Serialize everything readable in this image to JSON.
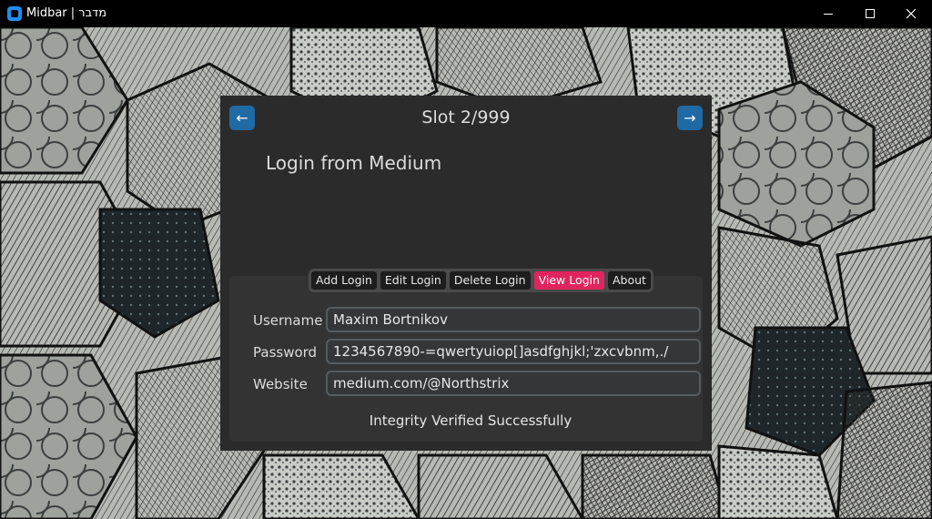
{
  "window": {
    "title": "Midbar | מדבר",
    "minimize_icon": "minimize-icon",
    "maximize_icon": "maximize-icon",
    "close_icon": "close-icon",
    "accent": "#1f8ef1"
  },
  "nav": {
    "prev_label": "←",
    "next_label": "→",
    "slot_title": "Slot 2/999",
    "button_color": "#1f6aa5"
  },
  "entry": {
    "title": "Login from Medium"
  },
  "tabs": [
    {
      "label": "Add Login",
      "active": false
    },
    {
      "label": "Edit Login",
      "active": false
    },
    {
      "label": "Delete Login",
      "active": false
    },
    {
      "label": "View Login",
      "active": true
    },
    {
      "label": "About",
      "active": false
    }
  ],
  "tab_active_color": "#e0245e",
  "fields": {
    "username": {
      "label": "Username",
      "value": "Maxim Bortnikov"
    },
    "password": {
      "label": "Password",
      "value": "1234567890-=qwertyuiop[]asdfghjkl;'zxcvbnm,./"
    },
    "website": {
      "label": "Website",
      "value": "medium.com/@Northstrix"
    }
  },
  "status": "Integrity Verified Successfully"
}
